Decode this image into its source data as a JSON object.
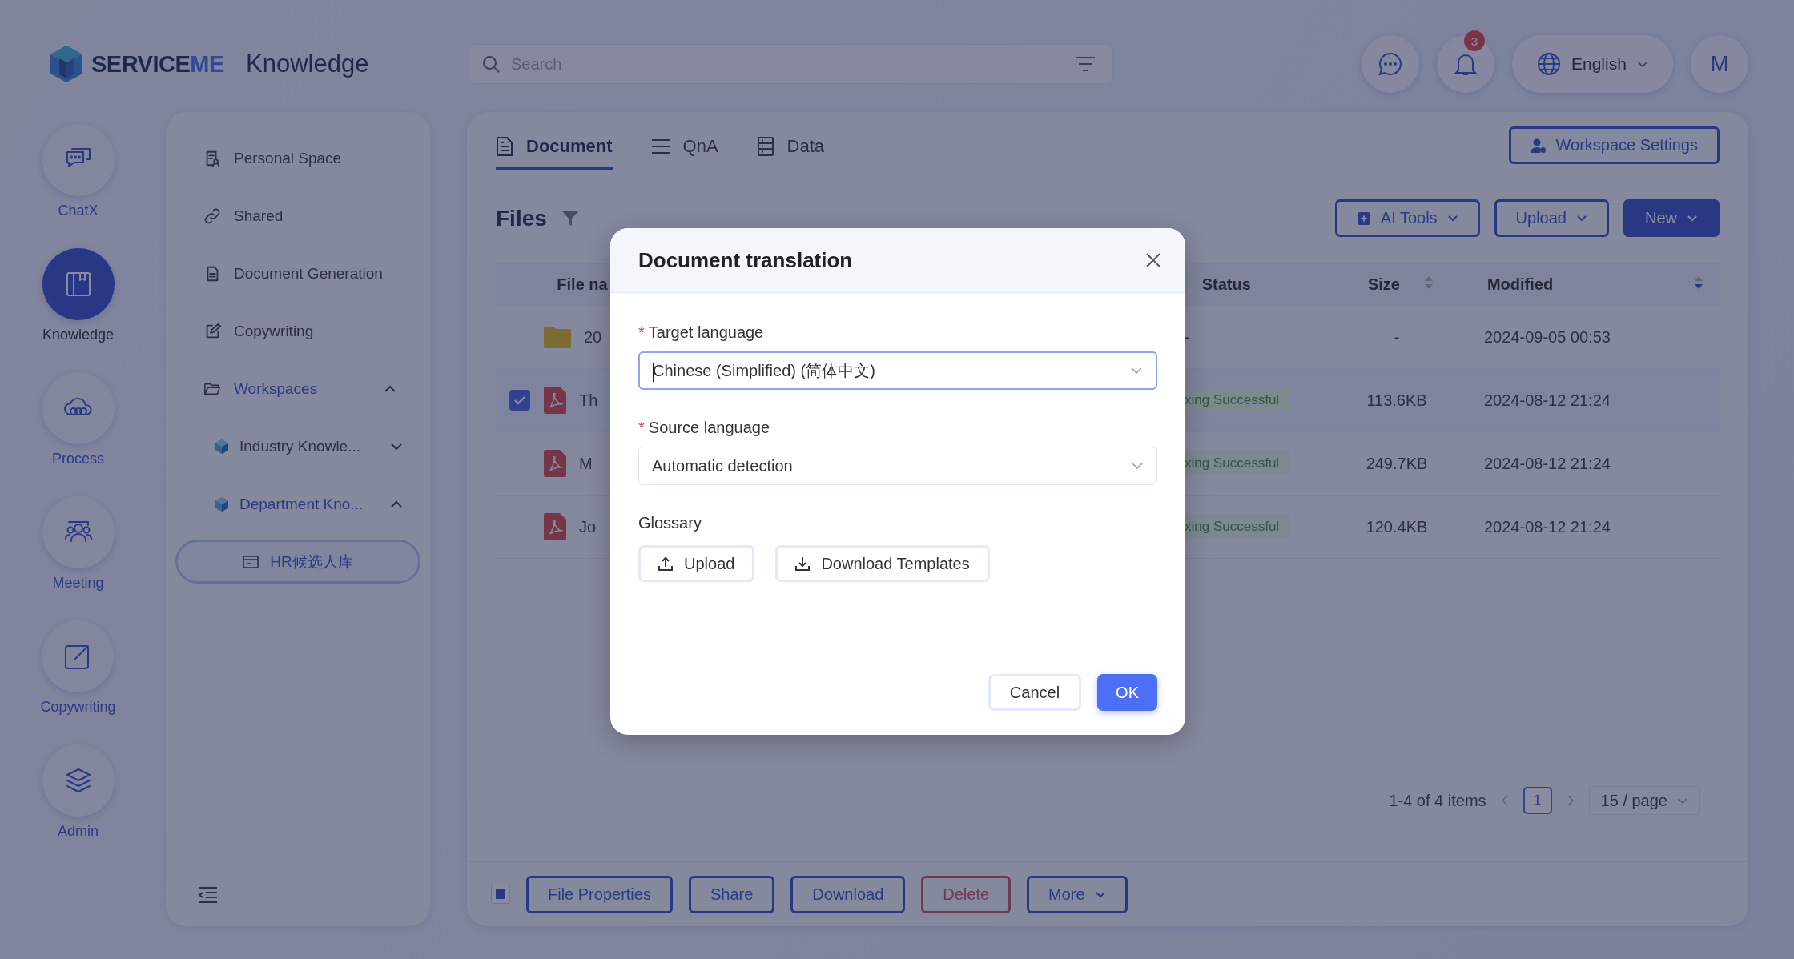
{
  "brand": {
    "logo_prefix": "SERVICE",
    "logo_suffix": "ME",
    "title": "Knowledge"
  },
  "search": {
    "placeholder": "Search"
  },
  "header": {
    "notification_count": "3",
    "language": "English",
    "avatar_initial": "M"
  },
  "rail": [
    {
      "label": "ChatX",
      "selected": false
    },
    {
      "label": "Knowledge",
      "selected": true
    },
    {
      "label": "Process",
      "selected": false
    },
    {
      "label": "Meeting",
      "selected": false
    },
    {
      "label": "Copywriting",
      "selected": false
    },
    {
      "label": "Admin",
      "selected": false
    }
  ],
  "sidebar": {
    "items": [
      {
        "label": "Personal Space"
      },
      {
        "label": "Shared"
      },
      {
        "label": "Document Generation"
      },
      {
        "label": "Copywriting"
      }
    ],
    "workspaces": {
      "label": "Workspaces",
      "expanded": true,
      "children": [
        {
          "label": "Industry Knowle...",
          "expanded": false
        },
        {
          "label": "Department Kno...",
          "expanded": true,
          "children": [
            {
              "label": "HR候选人库",
              "selected": true
            }
          ]
        }
      ]
    }
  },
  "tabs": [
    {
      "label": "Document",
      "selected": true
    },
    {
      "label": "QnA",
      "selected": false
    },
    {
      "label": "Data",
      "selected": false
    }
  ],
  "workspace_settings": "Workspace Settings",
  "files": {
    "title": "Files",
    "actions": [
      {
        "label": "AI Tools",
        "kind": "outline"
      },
      {
        "label": "Upload",
        "kind": "outline"
      },
      {
        "label": "New",
        "kind": "primary"
      }
    ]
  },
  "table": {
    "columns": [
      {
        "label": "File na"
      },
      {
        "label": "Status"
      },
      {
        "label": "Size",
        "sortable": true,
        "sort_descending": false
      },
      {
        "label": "Modified",
        "sortable": true,
        "sort_descending": true
      }
    ],
    "rows": [
      {
        "kind": "folder",
        "name": "20",
        "status": "-",
        "status_tag": false,
        "size": "-",
        "modified": "2024-09-05 00:53",
        "selected": false
      },
      {
        "kind": "pdf",
        "name": "Th",
        "status": "xing Successful",
        "status_tag": true,
        "size": "113.6KB",
        "modified": "2024-08-12 21:24",
        "selected": true
      },
      {
        "kind": "pdf",
        "name": "M",
        "status": "xing Successful",
        "status_tag": true,
        "size": "249.7KB",
        "modified": "2024-08-12 21:24",
        "selected": false
      },
      {
        "kind": "pdf",
        "name": "Jo",
        "status": "xing Successful",
        "status_tag": true,
        "size": "120.4KB",
        "modified": "2024-08-12 21:24",
        "selected": false
      }
    ]
  },
  "pagination": {
    "summary": "1-4 of 4 items",
    "pages": [
      {
        "label": "1",
        "selected": true
      }
    ],
    "page_size": "15 / page"
  },
  "footer": {
    "select_all": {
      "indeterminate": true
    },
    "buttons": [
      {
        "label": "File Properties",
        "kind": "outline"
      },
      {
        "label": "Share",
        "kind": "outline"
      },
      {
        "label": "Download",
        "kind": "outline"
      },
      {
        "label": "Delete",
        "kind": "danger"
      },
      {
        "label": "More",
        "kind": "menu"
      }
    ]
  },
  "modal": {
    "title": "Document translation",
    "fields": [
      {
        "label": "Target language",
        "required_mark": "*",
        "value": "Chinese (Simplified) (简体中文)",
        "focused": true
      },
      {
        "label": "Source language",
        "required_mark": "*",
        "value": "Automatic detection",
        "focused": false
      }
    ],
    "glossary": {
      "label": "Glossary",
      "buttons": [
        {
          "label": "Upload",
          "kind": "upload"
        },
        {
          "label": "Download Templates",
          "kind": "download"
        }
      ]
    },
    "buttons": [
      {
        "label": "Cancel",
        "kind": "default"
      },
      {
        "label": "OK",
        "kind": "primary"
      }
    ]
  }
}
